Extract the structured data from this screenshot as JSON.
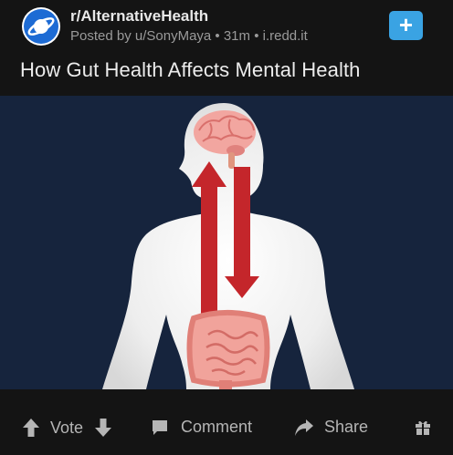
{
  "post": {
    "subreddit": "r/AlternativeHealth",
    "meta": "Posted by u/SonyMaya • 31m • i.redd.it",
    "title": "How Gut Health Affects Mental Health"
  },
  "icons": {
    "subreddit_avatar": "planet-icon",
    "join": "plus-icon",
    "upvote": "arrow-up-icon",
    "downvote": "arrow-down-icon",
    "comment": "comment-bubble-icon",
    "share": "share-arrow-icon",
    "award": "gift-icon"
  },
  "footer": {
    "vote_label": "Vote",
    "comment_label": "Comment",
    "share_label": "Share"
  },
  "colors": {
    "background": "#141414",
    "accent": "#3aa3e3",
    "image_background": "#16243d",
    "arrow_red": "#c4262b"
  }
}
